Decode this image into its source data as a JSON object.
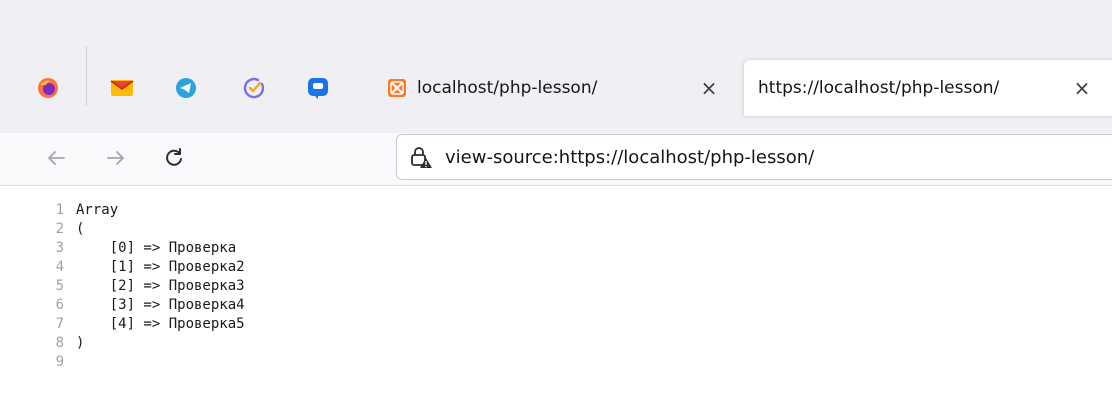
{
  "browser": {
    "pinned": [
      {
        "name": "firefox-icon",
        "color": "#ff7139"
      },
      {
        "name": "gmail-icon",
        "color": "#ea4335"
      },
      {
        "name": "telegram-icon",
        "color": "#2aa3df"
      },
      {
        "name": "tasks-check-icon",
        "color": "#7a6ff0"
      },
      {
        "name": "chat-icon",
        "color": "#1a73e8"
      }
    ],
    "tabs": [
      {
        "title": "localhost/php-lesson/",
        "active": false
      },
      {
        "title": "https://localhost/php-lesson/",
        "active": true
      }
    ],
    "close_glyph": "×",
    "url": "view-source:https://localhost/php-lesson/"
  },
  "source": {
    "lines": [
      {
        "n": "1",
        "text": "Array"
      },
      {
        "n": "2",
        "text": "("
      },
      {
        "n": "3",
        "text": "    [0] => Проверка"
      },
      {
        "n": "4",
        "text": "    [1] => Проверка2"
      },
      {
        "n": "5",
        "text": "    [2] => Проверка3"
      },
      {
        "n": "6",
        "text": "    [3] => Проверка4"
      },
      {
        "n": "7",
        "text": "    [4] => Проверка5"
      },
      {
        "n": "8",
        "text": ")"
      },
      {
        "n": "9",
        "text": ""
      }
    ]
  }
}
